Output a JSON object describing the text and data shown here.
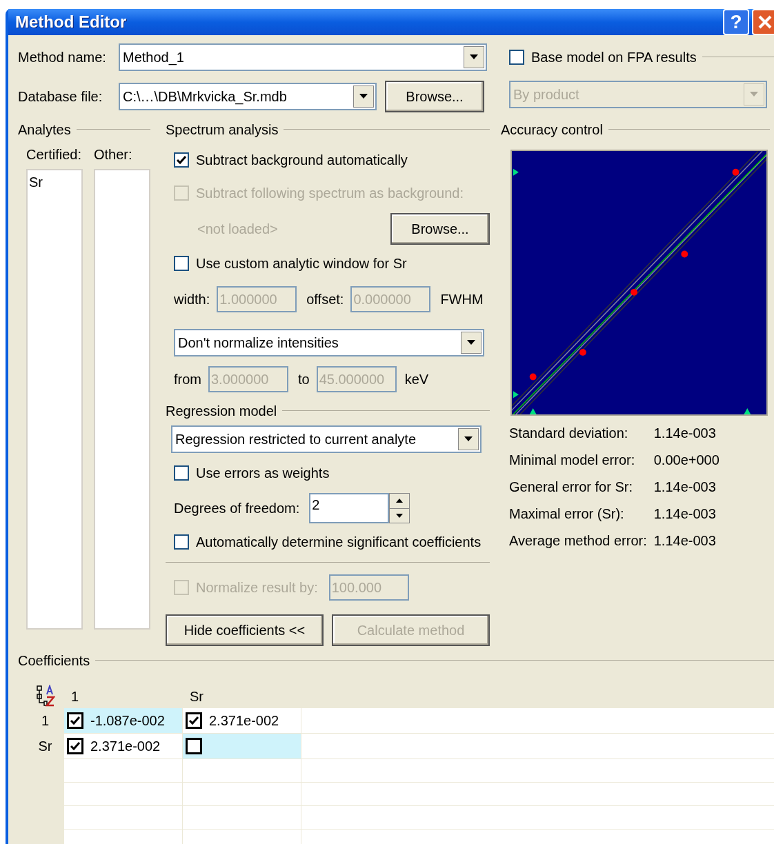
{
  "window": {
    "title": "Method Editor",
    "help": "?"
  },
  "method_name": {
    "label": "Method name:",
    "value": "Method_1"
  },
  "database_file": {
    "label": "Database file:",
    "value": "C:\\…\\DB\\Mrkvicka_Sr.mdb",
    "browse": "Browse..."
  },
  "fpa": {
    "label": "Base model on FPA results",
    "checked": false,
    "mode": {
      "value": "By product",
      "disabled": true
    }
  },
  "analytes": {
    "title": "Analytes",
    "certified": {
      "label": "Certified:",
      "items": [
        "Sr"
      ]
    },
    "other": {
      "label": "Other:"
    }
  },
  "spectrum_analysis": {
    "title": "Spectrum analysis",
    "subtract_auto": {
      "label": "Subtract background automatically",
      "checked": true,
      "disabled": false
    },
    "subtract_following": {
      "label": "Subtract following spectrum as background:",
      "checked": false,
      "disabled": true
    },
    "background_file": {
      "value": "<not loaded>",
      "disabled": true
    },
    "browse": "Browse...",
    "custom_window": {
      "label": "Use custom analytic window for Sr",
      "checked": false,
      "disabled": false
    },
    "width": {
      "label": "width:",
      "value": "1.000000",
      "disabled": true
    },
    "offset": {
      "label": "offset:",
      "value": "0.000000",
      "disabled": true
    },
    "window_unit": "FWHM",
    "normalize_mode": "Don't normalize intensities",
    "from": {
      "label": "from",
      "value": "3.000000",
      "disabled": true
    },
    "to": {
      "label": "to",
      "value": "45.000000",
      "disabled": true
    },
    "range_unit": "keV"
  },
  "regression_model": {
    "title": "Regression model",
    "mode": "Regression restricted to current analyte",
    "errors_as_weights": {
      "label": "Use errors as weights",
      "checked": false,
      "disabled": false
    },
    "degrees_of_freedom": {
      "label": "Degrees of freedom:",
      "value": "2"
    },
    "auto_coefficients": {
      "label": "Automatically determine significant coefficients",
      "checked": false,
      "disabled": false
    }
  },
  "normalize_result": {
    "label": "Normalize result by:",
    "checked": false,
    "value": "100.000",
    "disabled": true
  },
  "buttons": [
    {
      "label": "Hide coefficients <<",
      "disabled": false
    },
    {
      "label": "Calculate method",
      "disabled": true
    }
  ],
  "accuracy_control": {
    "title": "Accuracy control",
    "stats": [
      {
        "label": "Standard deviation:",
        "value": "1.14e-003"
      },
      {
        "label": "Minimal model error:",
        "value": "0.00e+000"
      },
      {
        "label": "General error for Sr:",
        "value": "1.14e-003"
      },
      {
        "label": "Maximal error (Sr):",
        "value": "1.14e-003"
      },
      {
        "label": "Average method error:",
        "value": "1.14e-003"
      }
    ]
  },
  "coefficients": {
    "title": "Coefficients",
    "columns": [
      "1",
      "Sr"
    ],
    "rows": [
      {
        "label": "1",
        "cells": [
          {
            "checked": true,
            "value": "-1.087e-002",
            "highlighted": true
          },
          {
            "checked": true,
            "value": "2.371e-002",
            "highlighted": false
          }
        ]
      },
      {
        "label": "Sr",
        "cells": [
          {
            "checked": true,
            "value": "2.371e-002",
            "highlighted": false
          },
          {
            "checked": false,
            "highlighted": true
          }
        ]
      }
    ]
  }
}
